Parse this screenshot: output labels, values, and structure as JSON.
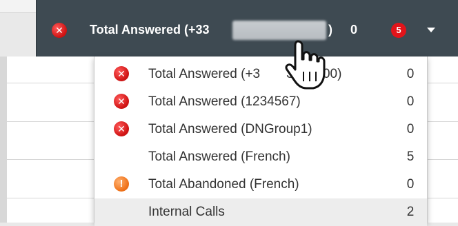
{
  "header": {
    "status_icon": "error-x-icon",
    "label_prefix": "Total Answered (+33",
    "label_suffix": ")",
    "count": "0",
    "badge_count": "5",
    "dropdown_icon": "caret-down-icon"
  },
  "dropdown": {
    "items": [
      {
        "icon": "error-x-icon",
        "label": "Total Answered (+3",
        "label_tail": "3020000)",
        "value": "0"
      },
      {
        "icon": "error-x-icon",
        "label": "Total Answered (1234567)",
        "value": "0"
      },
      {
        "icon": "error-x-icon",
        "label": "Total Answered (DNGroup1)",
        "value": "0"
      },
      {
        "icon": "",
        "label": "Total Answered (French)",
        "value": "5"
      },
      {
        "icon": "warning-exclamation-icon",
        "label": "Total Abandoned (French)",
        "value": "0"
      },
      {
        "icon": "",
        "label": "Internal Calls",
        "value": "2"
      }
    ]
  },
  "colors": {
    "header_bg": "#3e4a52",
    "error": "#d11515",
    "warning": "#f0731a",
    "badge": "#e2141a"
  }
}
